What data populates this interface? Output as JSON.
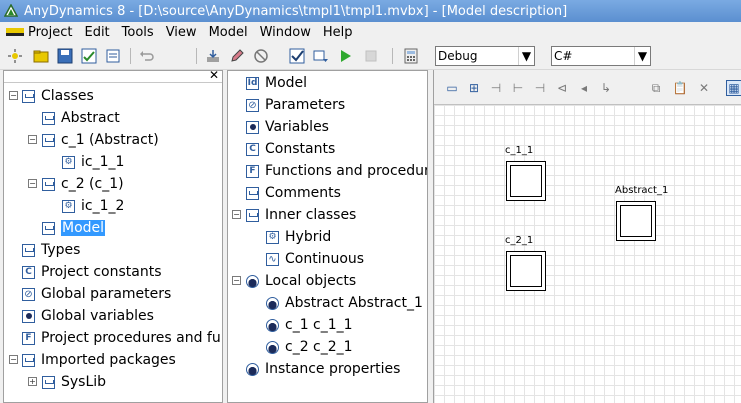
{
  "window": {
    "title": "AnyDynamics 8 - [D:\\source\\AnyDynamics\\tmpl1\\tmpl1.mvbx] - [Model description]"
  },
  "menu": [
    "Project",
    "Edit",
    "Tools",
    "View",
    "Model",
    "Window",
    "Help"
  ],
  "toolbar": {
    "config_value": "Debug",
    "language_value": "C#"
  },
  "left_tree": {
    "classes": "Classes",
    "abstract": "Abstract",
    "c1": "c_1 (Abstract)",
    "ic11": "ic_1_1",
    "c2": "c_2 (c_1)",
    "ic12": "ic_1_2",
    "model": "Model",
    "types": "Types",
    "project_constants": "Project constants",
    "global_parameters": "Global parameters",
    "global_variables": "Global variables",
    "project_procedures": "Project procedures and functions",
    "imported_packages": "Imported packages",
    "syslib": "SysLib"
  },
  "mid_tree": {
    "model": "Model",
    "parameters": "Parameters",
    "variables": "Variables",
    "constants": "Constants",
    "functions": "Functions and procedures",
    "comments": "Comments",
    "inner_classes": "Inner classes",
    "hybrid": "Hybrid",
    "continuous": "Continuous",
    "local_objects": "Local objects",
    "obj_abstract": "Abstract Abstract_1",
    "obj_c1": "c_1 c_1_1",
    "obj_c2": "c_2 c_2_1",
    "instance_properties": "Instance properties"
  },
  "canvas": {
    "blocks": [
      "c_1_1",
      "c_2_1",
      "Abstract_1"
    ]
  }
}
